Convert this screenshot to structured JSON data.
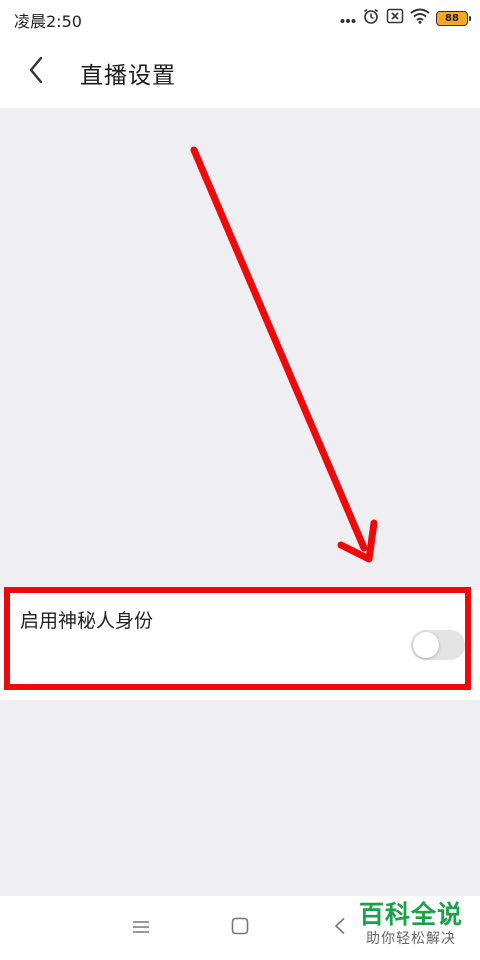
{
  "status_bar": {
    "time": "凌晨2:50",
    "battery": "88",
    "icons": [
      "more-dots-icon",
      "alarm-icon",
      "sim-off-icon",
      "wifi-icon",
      "battery-icon"
    ]
  },
  "header": {
    "back_icon": "chevron-left-icon",
    "title": "直播设置"
  },
  "settings": {
    "incognito": {
      "label": "启用神秘人身份",
      "enabled": false
    }
  },
  "annotation": {
    "arrow_color": "#ee0a0a",
    "box_color": "#ee0a0a"
  },
  "nav_bar": {
    "icons": [
      "menu-icon",
      "home-square-icon",
      "back-triangle-icon"
    ]
  },
  "watermark": {
    "main": "百科全说",
    "sub": "助你轻松解决",
    "color": "#18a348"
  }
}
